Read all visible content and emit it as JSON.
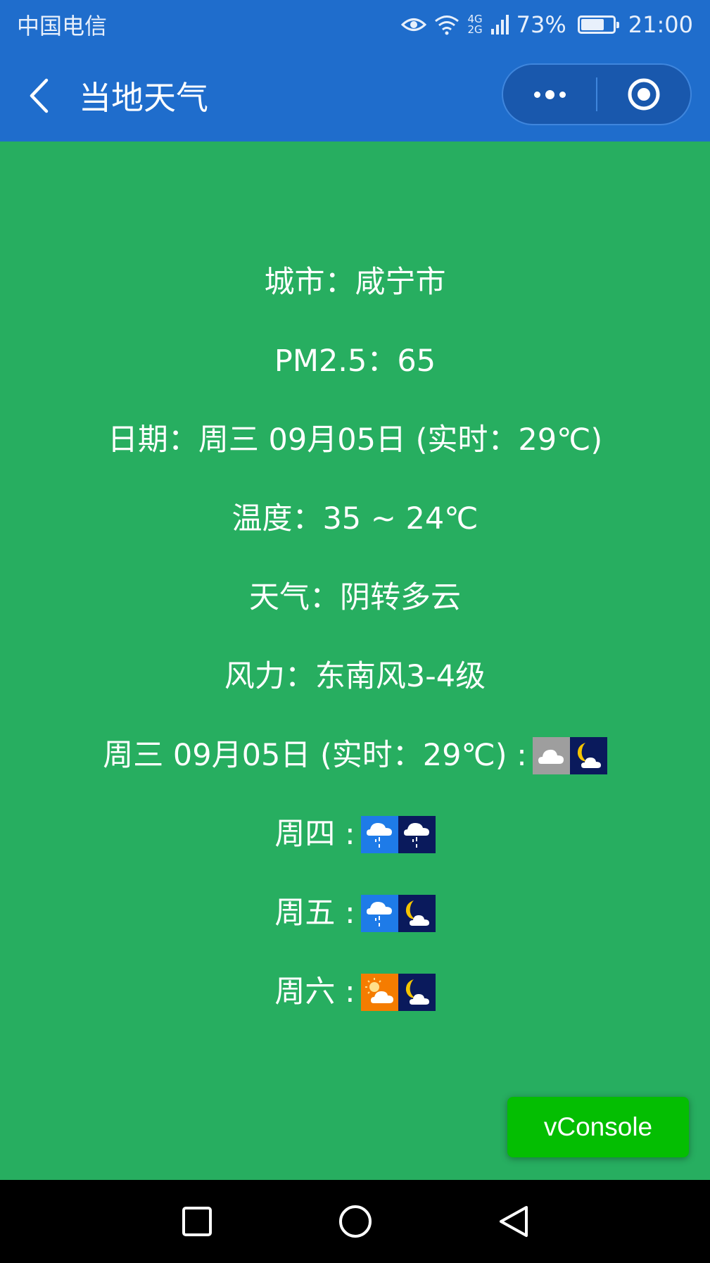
{
  "status_bar": {
    "carrier": "中国电信",
    "network_top": "4G",
    "network_bottom": "2G",
    "battery_percent": "73%",
    "battery_level": 0.73,
    "time": "21:00"
  },
  "nav": {
    "title": "当地天气"
  },
  "weather": {
    "city_line": "城市：咸宁市",
    "pm25_line": "PM2.5：65",
    "date_line": "日期：周三 09月05日 (实时：29℃)",
    "temp_line": "温度：35 ~ 24℃",
    "weather_line": "天气：阴转多云",
    "wind_line": "风力：东南风3-4级"
  },
  "forecast": [
    {
      "label": "周三 09月05日 (实时：29℃) :",
      "day_icon": "cloudy-icon",
      "night_icon": "moon-cloud-icon"
    },
    {
      "label": "周四 :",
      "day_icon": "rain-icon",
      "night_icon": "rain-night-icon"
    },
    {
      "label": "周五 :",
      "day_icon": "rain-icon",
      "night_icon": "moon-cloud-icon"
    },
    {
      "label": "周六 :",
      "day_icon": "sun-cloud-icon",
      "night_icon": "moon-cloud-icon"
    }
  ],
  "vconsole": {
    "label": "vConsole"
  },
  "colors": {
    "nav_bg": "#1f6dcc",
    "content_bg": "#27ae60",
    "vconsole_bg": "#04be02"
  }
}
